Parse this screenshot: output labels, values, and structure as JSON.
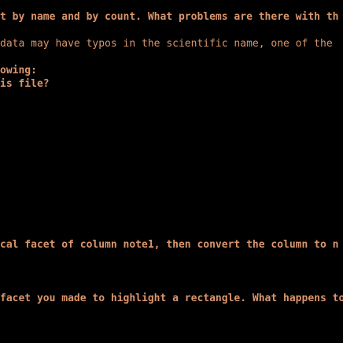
{
  "terminal": {
    "lines": [
      "t by name and by count. What problems are there with th",
      "data may have typos in the scientific name, one of the",
      "owing:",
      "is file?",
      "cal facet of column note1, then convert the column to n",
      "facet you made to highlight a rectangle. What happens to"
    ]
  }
}
